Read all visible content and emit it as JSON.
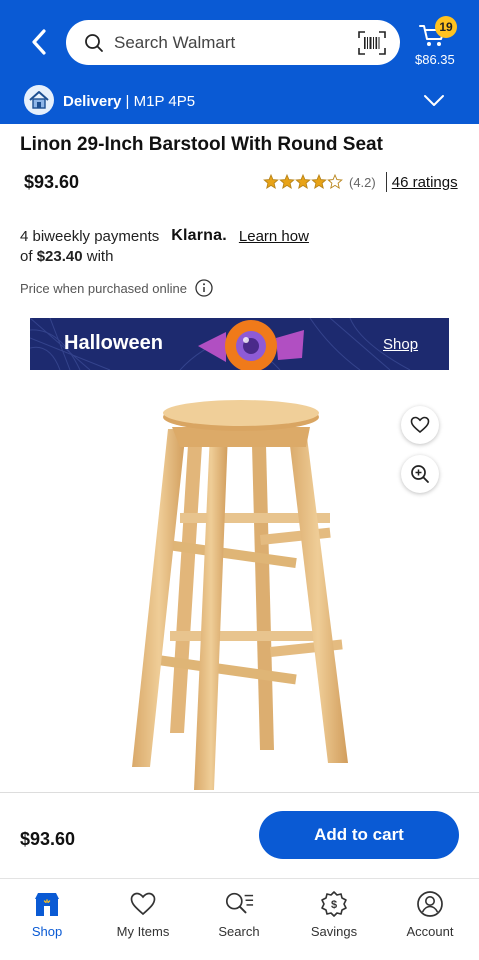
{
  "header": {
    "search_placeholder": "Search Walmart",
    "cart_count": "19",
    "cart_total": "$86.35"
  },
  "delivery": {
    "mode": "Delivery",
    "separator": "|",
    "postal_code": "M1P 4P5"
  },
  "product": {
    "title": "Linon 29-Inch Barstool With Round Seat",
    "price": "$93.60",
    "rating_value": "(4.2)",
    "rating_stars": 4.2,
    "rating_count": "46 ratings"
  },
  "klarna": {
    "line1_text": "4 biweekly payments",
    "logo": "Klarna.",
    "learn_how": "Learn how",
    "line2_prefix": "of",
    "installment": "$23.40",
    "line2_suffix": "with"
  },
  "price_note": "Price when purchased online",
  "banner": {
    "title": "Halloween",
    "cta": "Shop"
  },
  "buy_bar": {
    "price": "$93.60",
    "add_to_cart": "Add to cart"
  },
  "tabs": [
    {
      "label": "Shop",
      "icon": "store-icon",
      "active": true
    },
    {
      "label": "My Items",
      "icon": "heart-icon",
      "active": false
    },
    {
      "label": "Search",
      "icon": "search-list-icon",
      "active": false
    },
    {
      "label": "Savings",
      "icon": "savings-badge-icon",
      "active": false
    },
    {
      "label": "Account",
      "icon": "account-icon",
      "active": false
    }
  ],
  "colors": {
    "brand_blue": "#0a5ad4",
    "badge_yellow": "#ffc220",
    "banner_navy": "#1d2a6f",
    "star_gold": "#e8a317"
  }
}
